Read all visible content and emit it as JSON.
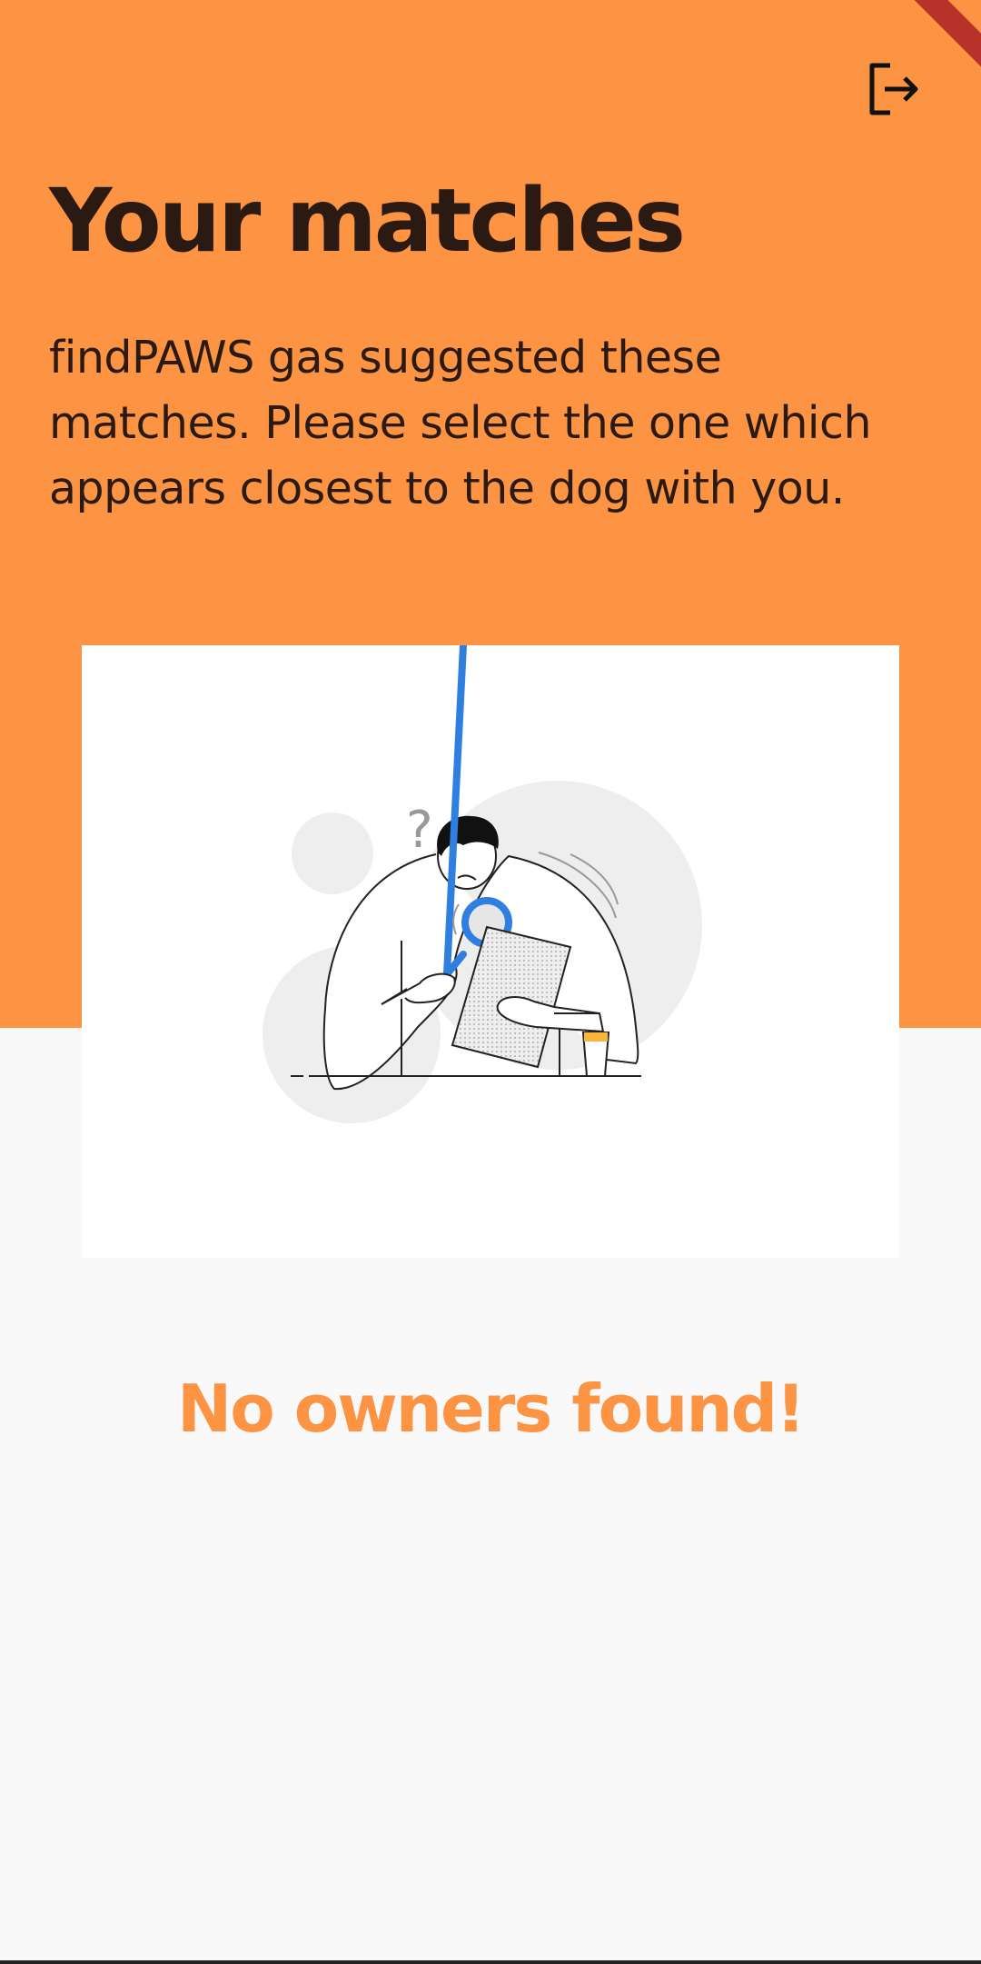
{
  "colors": {
    "accent": "#fc9444",
    "text_dark": "#2a1a12",
    "background": "#f9f9f9",
    "card": "#ffffff",
    "magnifier_blue": "#2f7fe0"
  },
  "header": {
    "logout_icon": "logout-icon",
    "title": "Your matches",
    "subtitle": "findPAWS gas suggested these matches. Please select the one which appears closest to the dog with you."
  },
  "empty_state": {
    "illustration_icon": "person-searching-illustration",
    "message": "No owners found!"
  }
}
